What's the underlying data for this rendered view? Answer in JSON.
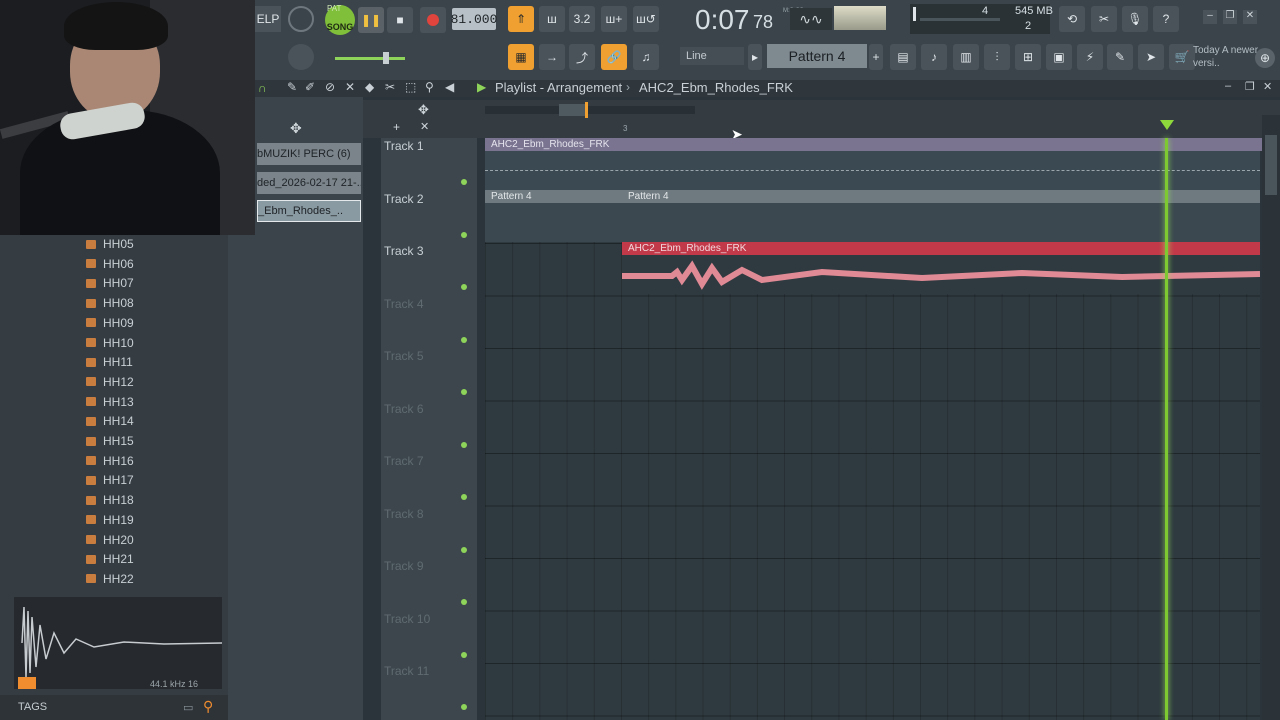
{
  "toolbar": {
    "help_label": "ELP",
    "song_label": "SONG",
    "pat_label": "PAT",
    "tempo": "81.000",
    "time_main": "0:07",
    "time_ms": "78",
    "time_format": "M:S:CS",
    "cpu_value": "4",
    "memory": "545 MB",
    "polyphony": "2",
    "snap_label": "Line",
    "pattern_label": "Pattern 4",
    "news_hint": "Today  A newer versi.."
  },
  "browser": {
    "items": [
      "HH05",
      "HH06",
      "HH07",
      "HH08",
      "HH09",
      "HH10",
      "HH11",
      "HH12",
      "HH13",
      "HH14",
      "HH15",
      "HH16",
      "HH17",
      "HH18",
      "HH19",
      "HH20",
      "HH21",
      "HH22"
    ],
    "wave_info": "44.1 kHz 16",
    "tags_label": "TAGS"
  },
  "picker": {
    "items": [
      "bMUZIK! PERC (6)",
      "ded_2026-02-17 21-..",
      "_Ebm_Rhodes_.."
    ]
  },
  "playlist": {
    "title": "Playlist - Arrangement",
    "breadcrumb": "AHC2_Ebm_Rhodes_FRK",
    "ruler_mark": "3",
    "tracks": [
      "Track 1",
      "Track 2",
      "Track 3",
      "Track 4",
      "Track 5",
      "Track 6",
      "Track 7",
      "Track 8",
      "Track 9",
      "Track 10",
      "Track 11"
    ],
    "clips": {
      "track1_clip": "AHC2_Ebm_Rhodes_FRK",
      "track2_clip_a": "Pattern 4",
      "track2_clip_b": "Pattern 4",
      "track3_clip": "AHC2_Ebm_Rhodes_FRK"
    }
  },
  "colors": {
    "accent_green": "#7ec832",
    "accent_orange": "#f0a030",
    "audio_clip_red": "#c23a4a",
    "pattern_clip": "#7b868c"
  }
}
